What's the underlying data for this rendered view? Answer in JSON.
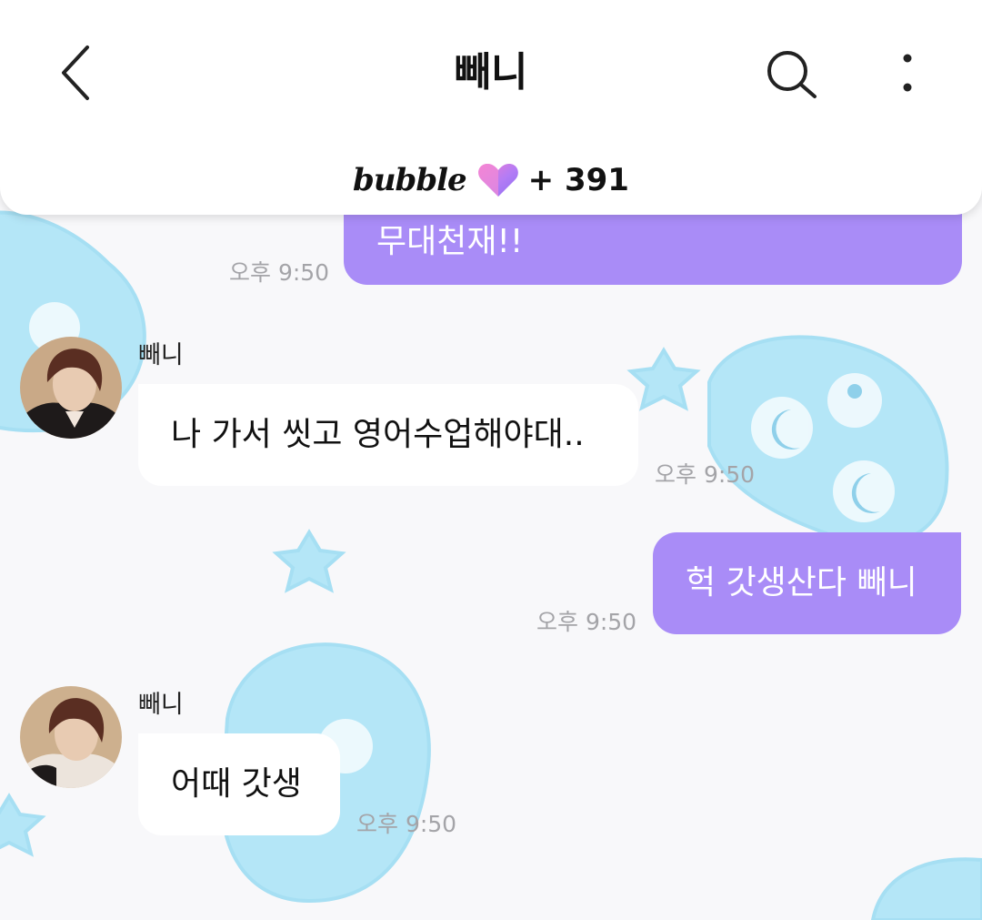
{
  "header": {
    "title": "빼니",
    "brand": "bubble",
    "count": "+ 391"
  },
  "icons": {
    "back": "chevron-left-icon",
    "search": "search-icon",
    "more": "more-vertical-icon",
    "heart": "heart-icon"
  },
  "colors": {
    "outgoing_bubble": "#a98cf7",
    "incoming_bubble": "#ffffff",
    "background": "#f8f8fa",
    "decoration": "#b4e6f7"
  },
  "messages": [
    {
      "direction": "outgoing",
      "text": "무대천재!!",
      "time": "오후 9:50"
    },
    {
      "direction": "incoming",
      "sender": "빼니",
      "text": "나 가서 씻고 영어수업해야대..",
      "time": "오후 9:50"
    },
    {
      "direction": "outgoing",
      "text": "헉 갓생산다 빼니",
      "time": "오후 9:50"
    },
    {
      "direction": "incoming",
      "sender": "빼니",
      "text": "어때 갓생",
      "time": "오후 9:50"
    }
  ]
}
